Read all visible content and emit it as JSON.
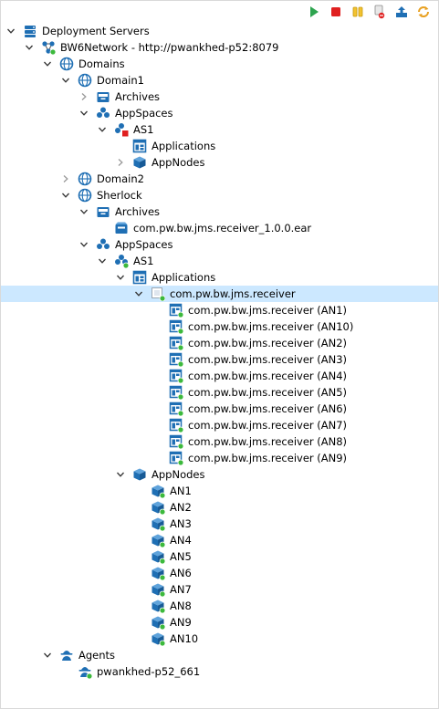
{
  "toolbar": {
    "buttons": [
      {
        "name": "start-icon"
      },
      {
        "name": "stop-icon"
      },
      {
        "name": "pause-icon"
      },
      {
        "name": "clear-icon"
      },
      {
        "name": "upload-icon"
      },
      {
        "name": "refresh-icon"
      }
    ]
  },
  "tree": [
    {
      "label": "Deployment Servers",
      "depth": 0,
      "twisty": "open",
      "icon": "server"
    },
    {
      "label": "BW6Network - http://pwankhed-p52:8079",
      "depth": 1,
      "twisty": "open",
      "icon": "network"
    },
    {
      "label": "Domains",
      "depth": 2,
      "twisty": "open",
      "icon": "globe"
    },
    {
      "label": "Domain1",
      "depth": 3,
      "twisty": "open",
      "icon": "globe"
    },
    {
      "label": "Archives",
      "depth": 4,
      "twisty": "closed",
      "icon": "archive"
    },
    {
      "label": "AppSpaces",
      "depth": 4,
      "twisty": "open",
      "icon": "appspaces"
    },
    {
      "label": "AS1",
      "depth": 5,
      "twisty": "open",
      "icon": "appspace-red"
    },
    {
      "label": "Applications",
      "depth": 6,
      "twisty": "none",
      "icon": "applications"
    },
    {
      "label": "AppNodes",
      "depth": 6,
      "twisty": "closed",
      "icon": "appnodes"
    },
    {
      "label": "Domain2",
      "depth": 3,
      "twisty": "closed",
      "icon": "globe"
    },
    {
      "label": "Sherlock",
      "depth": 3,
      "twisty": "open",
      "icon": "globe"
    },
    {
      "label": "Archives",
      "depth": 4,
      "twisty": "open",
      "icon": "archive"
    },
    {
      "label": "com.pw.bw.jms.receiver_1.0.0.ear",
      "depth": 5,
      "twisty": "none",
      "icon": "ear"
    },
    {
      "label": "AppSpaces",
      "depth": 4,
      "twisty": "open",
      "icon": "appspaces"
    },
    {
      "label": "AS1",
      "depth": 5,
      "twisty": "open",
      "icon": "appspace-green"
    },
    {
      "label": "Applications",
      "depth": 6,
      "twisty": "open",
      "icon": "applications"
    },
    {
      "label": "com.pw.bw.jms.receiver",
      "depth": 7,
      "twisty": "open",
      "icon": "app-running",
      "selected": true
    },
    {
      "label": "com.pw.bw.jms.receiver (AN1)",
      "depth": 8,
      "twisty": "none",
      "icon": "app-instance"
    },
    {
      "label": "com.pw.bw.jms.receiver (AN10)",
      "depth": 8,
      "twisty": "none",
      "icon": "app-instance"
    },
    {
      "label": "com.pw.bw.jms.receiver (AN2)",
      "depth": 8,
      "twisty": "none",
      "icon": "app-instance"
    },
    {
      "label": "com.pw.bw.jms.receiver (AN3)",
      "depth": 8,
      "twisty": "none",
      "icon": "app-instance"
    },
    {
      "label": "com.pw.bw.jms.receiver (AN4)",
      "depth": 8,
      "twisty": "none",
      "icon": "app-instance"
    },
    {
      "label": "com.pw.bw.jms.receiver (AN5)",
      "depth": 8,
      "twisty": "none",
      "icon": "app-instance"
    },
    {
      "label": "com.pw.bw.jms.receiver (AN6)",
      "depth": 8,
      "twisty": "none",
      "icon": "app-instance"
    },
    {
      "label": "com.pw.bw.jms.receiver (AN7)",
      "depth": 8,
      "twisty": "none",
      "icon": "app-instance"
    },
    {
      "label": "com.pw.bw.jms.receiver (AN8)",
      "depth": 8,
      "twisty": "none",
      "icon": "app-instance"
    },
    {
      "label": "com.pw.bw.jms.receiver (AN9)",
      "depth": 8,
      "twisty": "none",
      "icon": "app-instance"
    },
    {
      "label": "AppNodes",
      "depth": 6,
      "twisty": "open",
      "icon": "appnodes"
    },
    {
      "label": "AN1",
      "depth": 7,
      "twisty": "none",
      "icon": "appnode"
    },
    {
      "label": "AN2",
      "depth": 7,
      "twisty": "none",
      "icon": "appnode"
    },
    {
      "label": "AN3",
      "depth": 7,
      "twisty": "none",
      "icon": "appnode"
    },
    {
      "label": "AN4",
      "depth": 7,
      "twisty": "none",
      "icon": "appnode"
    },
    {
      "label": "AN5",
      "depth": 7,
      "twisty": "none",
      "icon": "appnode"
    },
    {
      "label": "AN6",
      "depth": 7,
      "twisty": "none",
      "icon": "appnode"
    },
    {
      "label": "AN7",
      "depth": 7,
      "twisty": "none",
      "icon": "appnode"
    },
    {
      "label": "AN8",
      "depth": 7,
      "twisty": "none",
      "icon": "appnode"
    },
    {
      "label": "AN9",
      "depth": 7,
      "twisty": "none",
      "icon": "appnode"
    },
    {
      "label": "AN10",
      "depth": 7,
      "twisty": "none",
      "icon": "appnode"
    },
    {
      "label": "Agents",
      "depth": 2,
      "twisty": "open",
      "icon": "agents"
    },
    {
      "label": "pwankhed-p52_661",
      "depth": 3,
      "twisty": "none",
      "icon": "agent"
    }
  ],
  "colors": {
    "selection": "#cce8ff",
    "icon_blue": "#1f6fb4",
    "status_green": "#3cb93c",
    "status_red": "#e02020"
  }
}
